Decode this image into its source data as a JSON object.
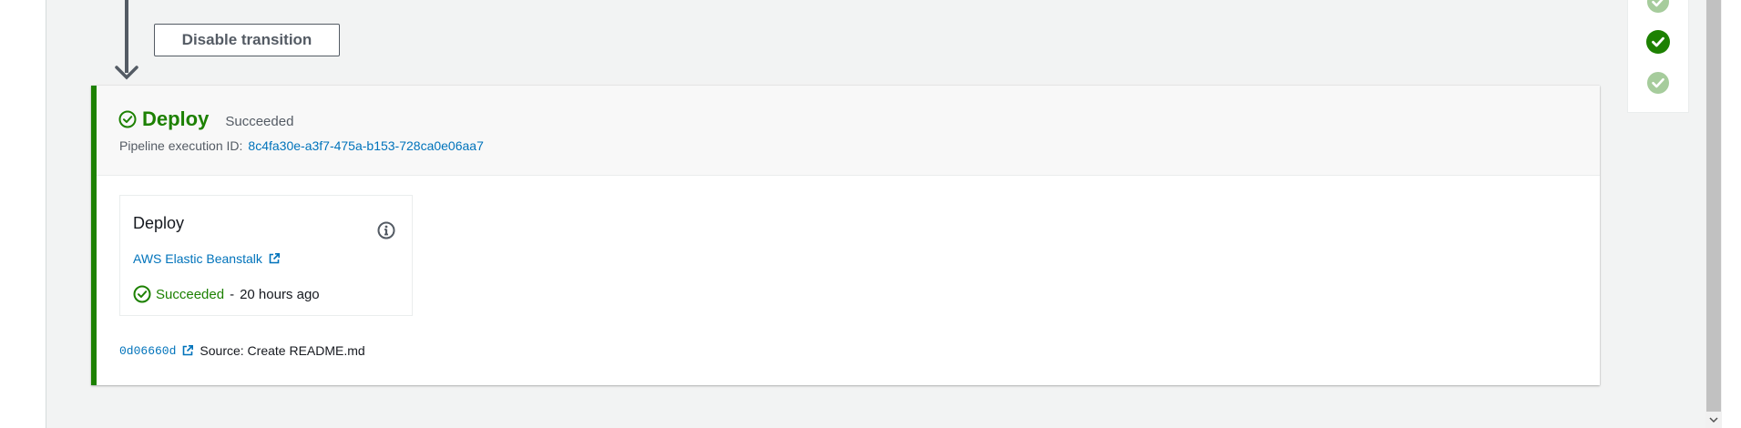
{
  "transition": {
    "disable_label": "Disable transition"
  },
  "stage": {
    "name": "Deploy",
    "status": "Succeeded",
    "execution_label": "Pipeline execution ID:",
    "execution_id": "8c4fa30e-a3f7-475a-b153-728ca0e06aa7",
    "action": {
      "name": "Deploy",
      "provider": "AWS Elastic Beanstalk",
      "status": "Succeeded",
      "separator": "-",
      "time_ago": "20 hours ago"
    },
    "source": {
      "commit_id": "0d06660d",
      "message": "Source: Create README.md"
    }
  },
  "colors": {
    "success": "#1d8102",
    "success_light": "#a6cc9c",
    "link": "#0073bb",
    "text_secondary": "#545b64"
  },
  "icons": {
    "stage_status": "check-circle-outline-icon",
    "info": "info-icon",
    "external_link": "external-link-icon",
    "mini_status": [
      "check-circle-light-icon",
      "check-circle-filled-icon",
      "check-circle-light-icon"
    ]
  }
}
